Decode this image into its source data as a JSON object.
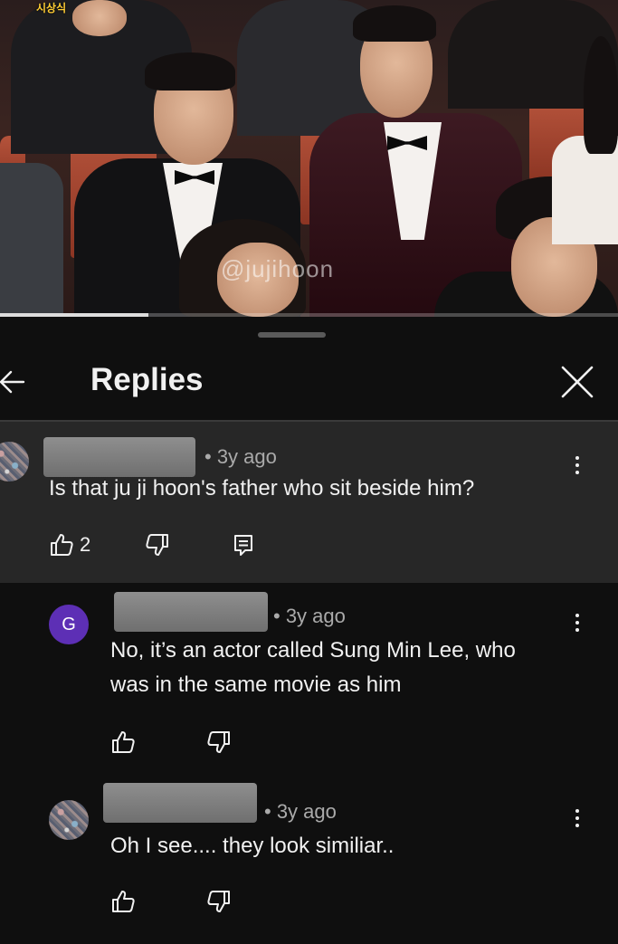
{
  "video": {
    "corner_label": "시상식",
    "watermark": "@jujihoon",
    "progress_fraction": 0.24
  },
  "header": {
    "title": "Replies"
  },
  "comments": [
    {
      "avatar": "textured",
      "time": "• 3y ago",
      "text": "Is that ju ji hoon's father who sit beside him?",
      "likes": "2"
    },
    {
      "avatar_letter": "G",
      "time": "• 3y ago",
      "text_line1": "No, it’s an actor called Sung Min Lee, who",
      "text_line2": "was in the same movie as him"
    },
    {
      "avatar": "textured",
      "time": "• 3y ago",
      "text": "Oh I see.... they look similiar.."
    }
  ],
  "colors": {
    "background": "#0f0f0f",
    "parent_comment_bg": "#272727",
    "avatar_purple": "#5d2fb5",
    "meta_gray": "#aaaaaa"
  },
  "icons": [
    "back-arrow-icon",
    "close-icon",
    "more-vert-icon",
    "thumb-up-icon",
    "thumb-down-icon",
    "reply-icon"
  ]
}
